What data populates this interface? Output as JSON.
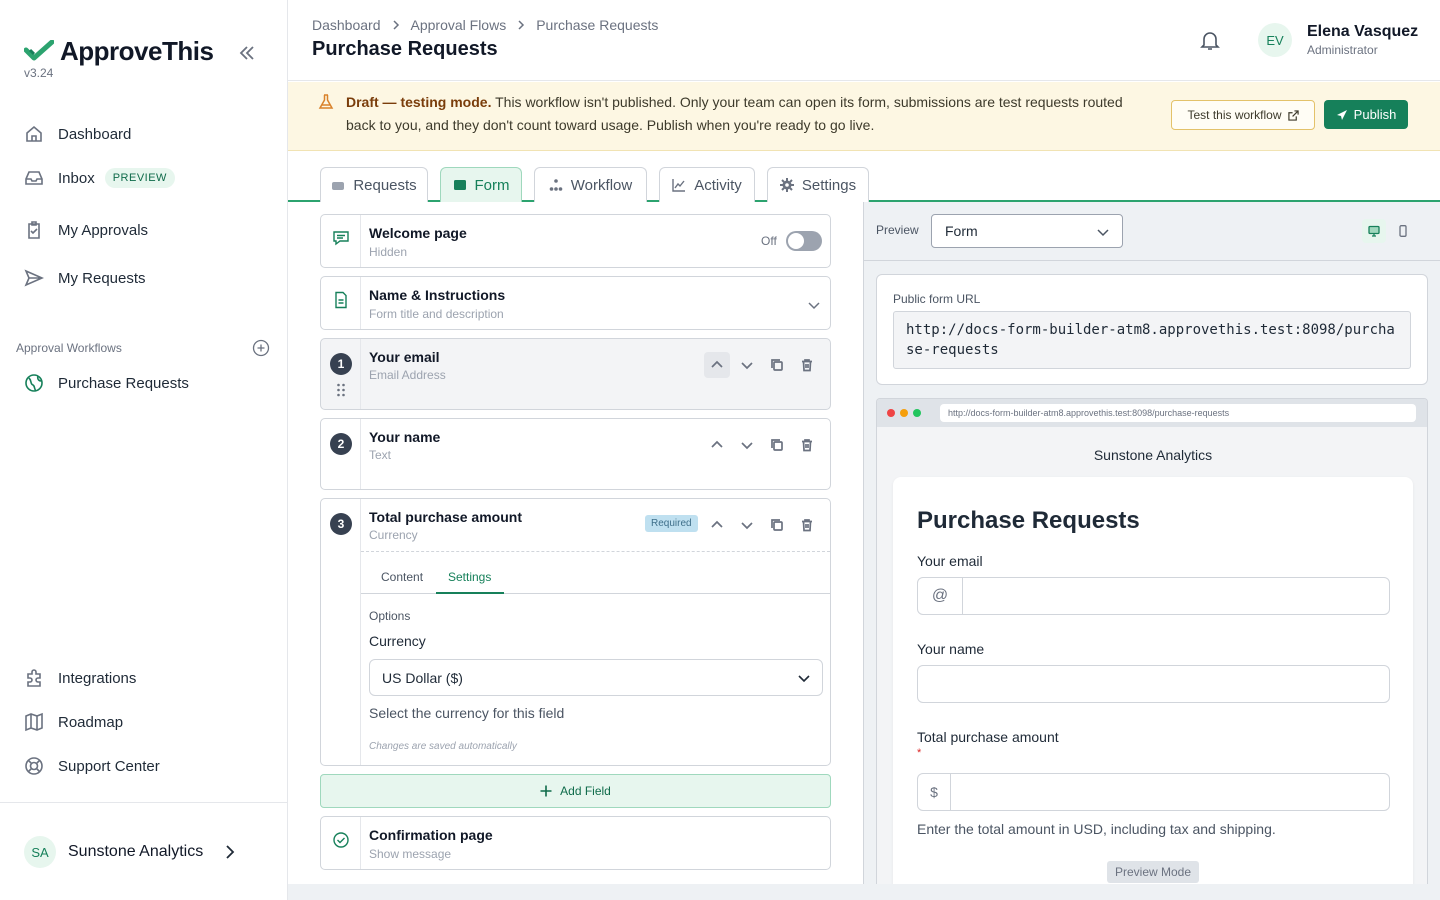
{
  "app": {
    "name": "ApproveThis",
    "version": "v3.24",
    "brand_color": "#16805a"
  },
  "sidebar": {
    "items": [
      {
        "label": "Dashboard",
        "icon": "home-icon"
      },
      {
        "label": "Inbox",
        "icon": "inbox-icon",
        "badge": "PREVIEW"
      },
      {
        "label": "My Approvals",
        "icon": "clipboard-icon"
      },
      {
        "label": "My Requests",
        "icon": "send-icon"
      }
    ],
    "section_label": "Approval Workflows",
    "workflows": [
      {
        "label": "Purchase Requests",
        "icon": "workflow-globe-icon"
      }
    ],
    "footer_items": [
      {
        "label": "Integrations",
        "icon": "puzzle-icon"
      },
      {
        "label": "Roadmap",
        "icon": "map-icon"
      },
      {
        "label": "Support Center",
        "icon": "lifebuoy-icon"
      }
    ],
    "org": {
      "initials": "SA",
      "name": "Sunstone Analytics"
    }
  },
  "header": {
    "breadcrumbs": [
      "Dashboard",
      "Approval Flows",
      "Purchase Requests"
    ],
    "title": "Purchase Requests",
    "user": {
      "initials": "EV",
      "name": "Elena Vasquez",
      "role": "Administrator"
    }
  },
  "banner": {
    "bold": "Draft — testing mode.",
    "text": " This workflow isn't published. Only your team can open its form, submissions are test requests routed back to you, and they don't count toward usage. Publish when you're ready to go live.",
    "test_button": "Test this workflow",
    "publish_button": "Publish"
  },
  "tabs": [
    "Requests",
    "Form",
    "Workflow",
    "Activity",
    "Settings"
  ],
  "active_tab": "Form",
  "builder": {
    "welcome": {
      "title": "Welcome page",
      "sub": "Hidden",
      "toggle_label": "Off"
    },
    "name_instructions": {
      "title": "Name & Instructions",
      "sub": "Form title and description"
    },
    "fields": [
      {
        "num": "1",
        "title": "Your email",
        "sub": "Email Address"
      },
      {
        "num": "2",
        "title": "Your name",
        "sub": "Text"
      },
      {
        "num": "3",
        "title": "Total purchase amount",
        "sub": "Currency",
        "badge": "Required"
      }
    ],
    "field3_tabs": [
      "Content",
      "Settings"
    ],
    "options_label": "Options",
    "currency_label": "Currency",
    "currency_value": "US Dollar ($)",
    "currency_hint": "Select the currency for this field",
    "autosave": "Changes are saved automatically",
    "add_field": "Add Field",
    "confirmation": {
      "title": "Confirmation page",
      "sub": "Show message"
    }
  },
  "preview": {
    "label": "Preview",
    "mode_value": "Form",
    "url_label": "Public form URL",
    "url": "http://docs-form-builder-atm8.approvethis.test:8098/purchase-requests",
    "browser_url": "http://docs-form-builder-atm8.approvethis.test:8098/purchase-requests",
    "org_name": "Sunstone Analytics",
    "form_title": "Purchase Requests",
    "email_label": "Your email",
    "email_addon": "@",
    "name_label": "Your name",
    "amount_label": "Total purchase amount",
    "required_mark": "*",
    "amount_addon": "$",
    "amount_help": "Enter the total amount in USD, including tax and shipping.",
    "preview_mode": "Preview Mode"
  }
}
